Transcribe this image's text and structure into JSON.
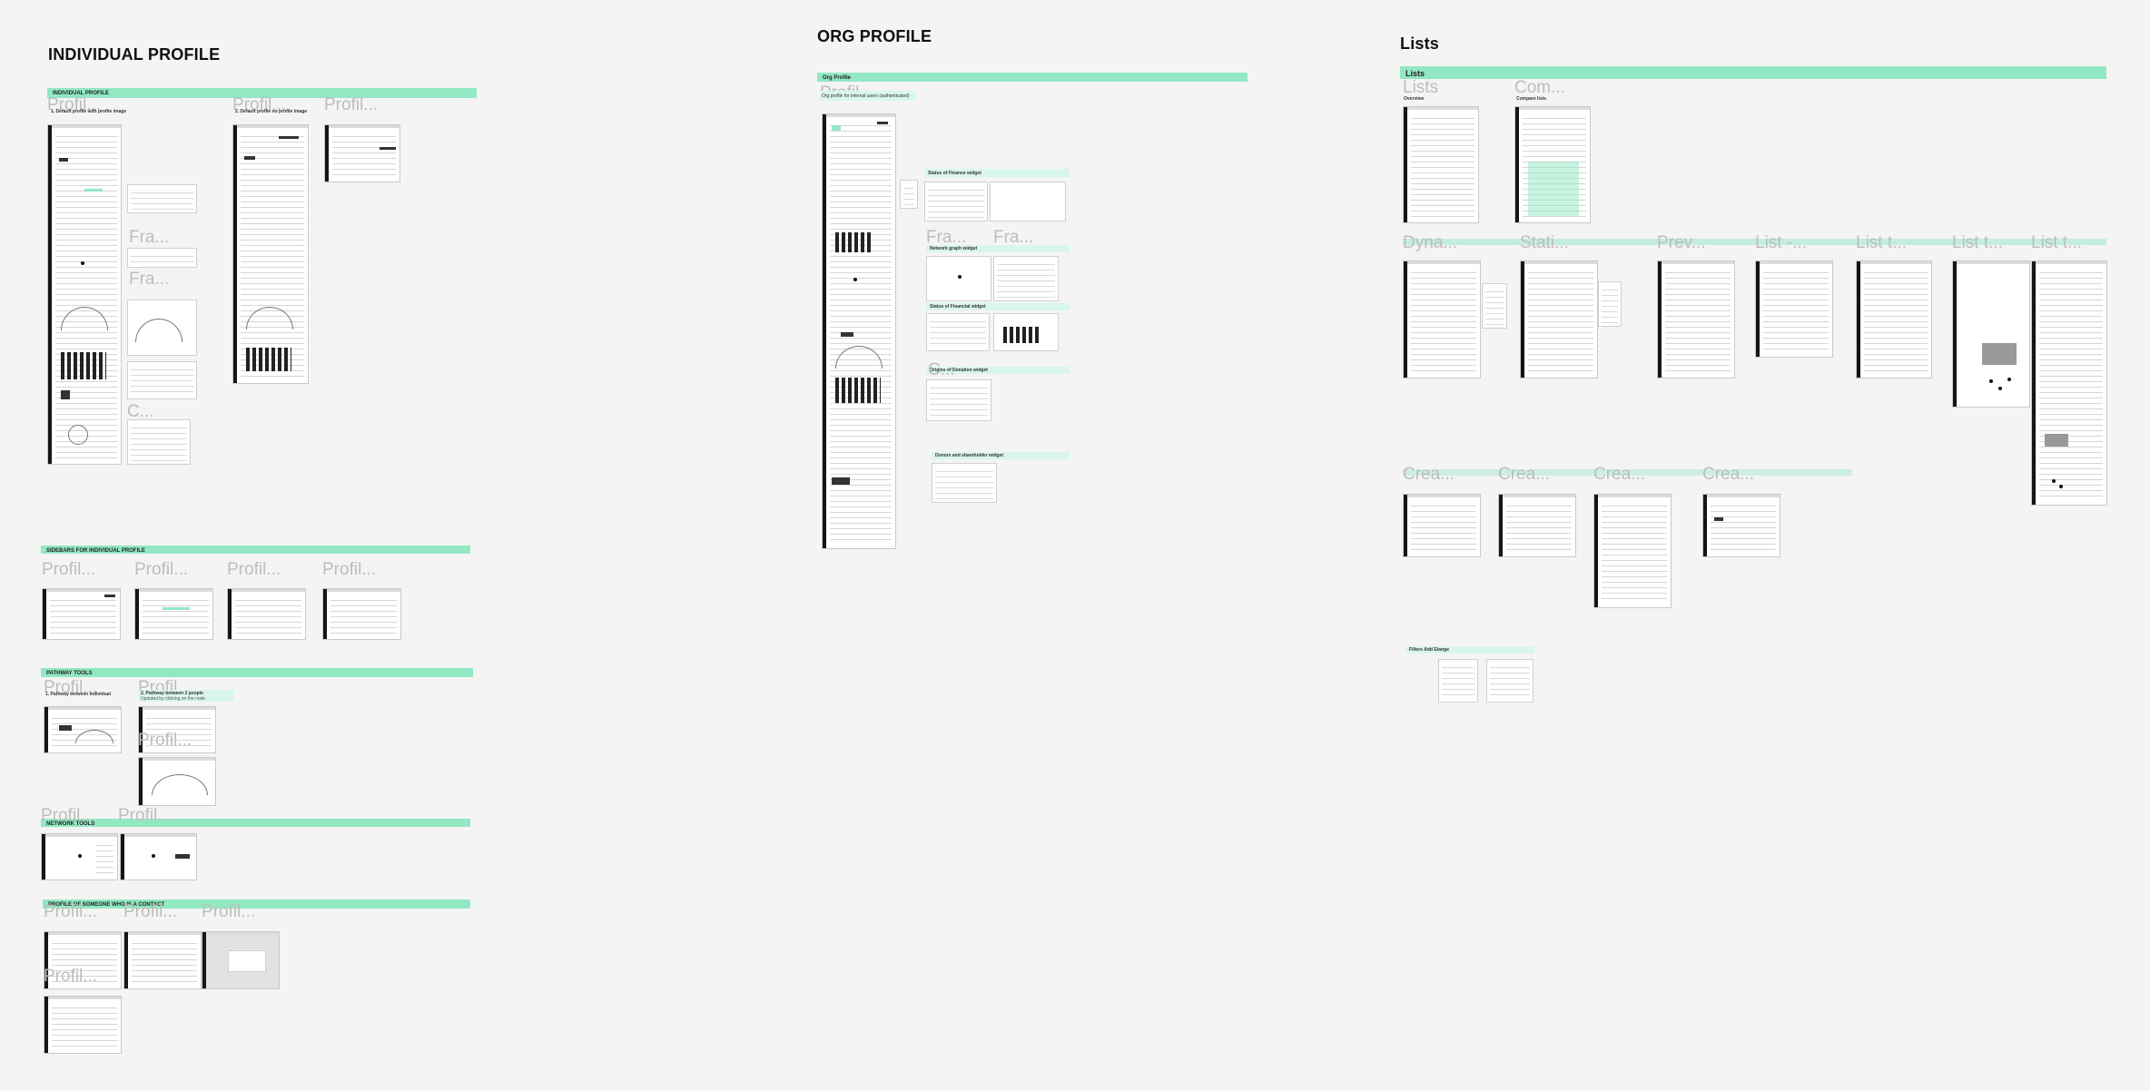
{
  "sections": {
    "individual": {
      "title": "INDIVIDUAL PROFILE",
      "band": "INDIVIDUAL PROFILE",
      "frames": [
        "Profil...",
        "Profil...",
        "Profil..."
      ],
      "sub1": "1. Default profile with profile image",
      "sub2": "2. Default profile no profile image",
      "side_labels": [
        "Fra...",
        "Fra...",
        "C..."
      ]
    },
    "sidebars": {
      "band": "SIDEBARS FOR INDIVIDUAL PROFILE",
      "frames": [
        "Profil...",
        "Profil...",
        "Profil...",
        "Profil..."
      ]
    },
    "pathway": {
      "band": "PATHWAY TOOLS",
      "frames": [
        "Profil...",
        "Profil...",
        "Profil..."
      ],
      "sub1": "1. Pathway between individual",
      "sub2": "2. Pathway between 2 people",
      "sub2b": "Updated by clicking on the node"
    },
    "network": {
      "band": "NETWORK TOOLS",
      "frames": [
        "Profil...",
        "Profil..."
      ]
    },
    "contact": {
      "band": "PROFILE OF SOMEONE WHO IS A CONTACT",
      "frames": [
        "Profil...",
        "Profil...",
        "Profil...",
        "Profil..."
      ]
    },
    "org": {
      "title": "ORG PROFILE",
      "band": "Org Profile",
      "frame": "Profil...",
      "sub": "Org profile for internal users (authenticated)",
      "widgets": [
        "Status of Finance widget",
        "Network graph widget",
        "Status of Financial widget",
        "Origins of Donation widget",
        "Donors and shareholder widget"
      ],
      "side_labels": [
        "Fra...",
        "Fra...",
        "C..."
      ]
    },
    "lists": {
      "title": "Lists",
      "band": "Lists",
      "row1": [
        "Lists",
        "Com..."
      ],
      "row1_sub": [
        "Overview",
        "Compare lists"
      ],
      "row2": [
        "Dyna...",
        "Stati...",
        "Prev...",
        "List -...",
        "List t...",
        "List t...",
        "List t..."
      ],
      "row3": [
        "Crea...",
        "Crea...",
        "Crea...",
        "Crea..."
      ],
      "filters": "Filters Add Etange"
    }
  }
}
